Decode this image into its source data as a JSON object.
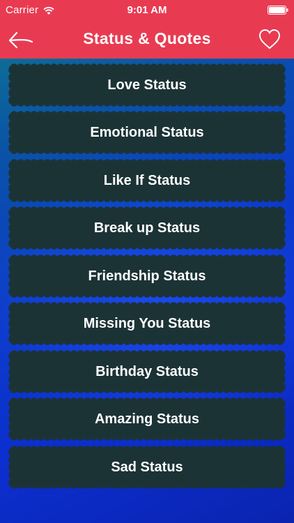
{
  "status_bar": {
    "carrier": "Carrier",
    "time": "9:01 AM"
  },
  "nav": {
    "title": "Status & Quotes",
    "back_icon": "back-arrow-icon",
    "favorite_icon": "heart-icon"
  },
  "colors": {
    "header": "#e83b52",
    "item_background": "#1c3336",
    "text": "#ffffff"
  },
  "categories": [
    {
      "label": "Love Status"
    },
    {
      "label": "Emotional Status"
    },
    {
      "label": "Like If Status"
    },
    {
      "label": "Break up Status"
    },
    {
      "label": "Friendship Status"
    },
    {
      "label": "Missing You Status"
    },
    {
      "label": "Birthday Status"
    },
    {
      "label": "Amazing Status"
    },
    {
      "label": "Sad Status"
    }
  ]
}
